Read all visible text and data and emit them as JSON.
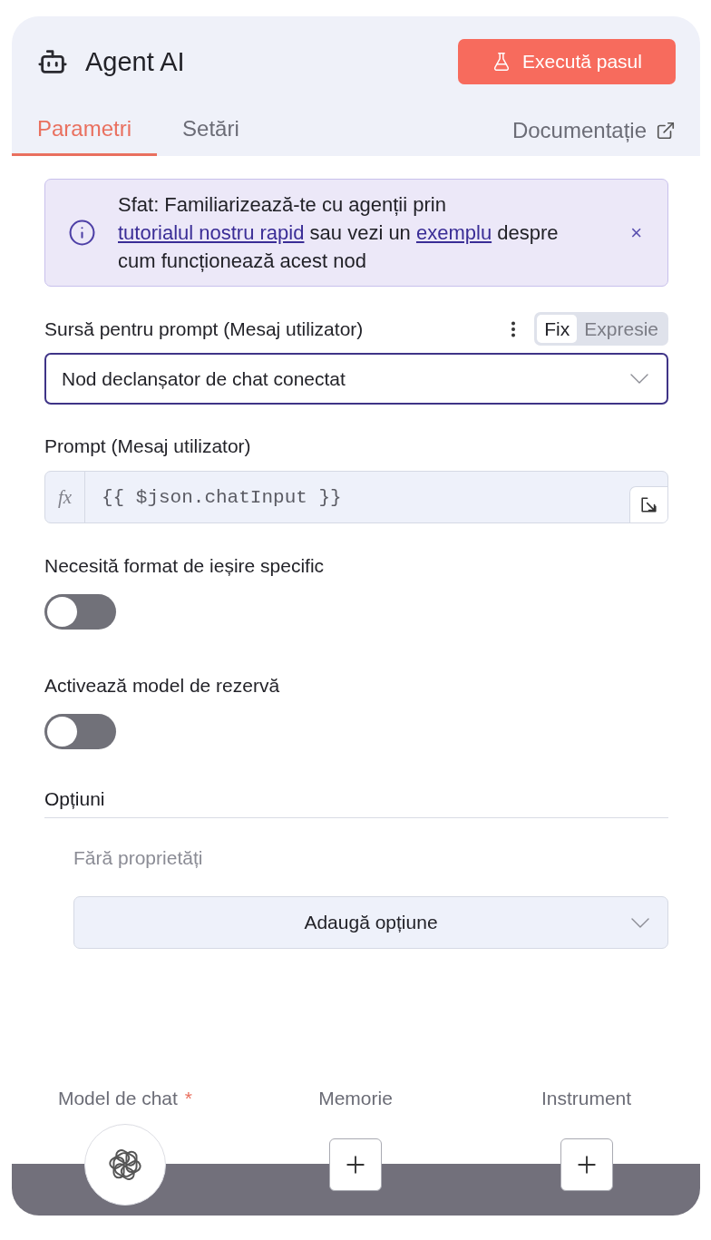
{
  "header": {
    "title": "Agent AI",
    "run_button": "Execută pasul"
  },
  "tabs": [
    {
      "label": "Parametri",
      "selected": true
    },
    {
      "label": "Setări",
      "selected": false
    }
  ],
  "docs_link": "Documentație",
  "tip": {
    "parts": [
      {
        "kind": "text",
        "text": "Sfat: Familiarizează-te cu agenții prin "
      },
      {
        "kind": "link",
        "text": "tutorialul nostru rapid"
      },
      {
        "kind": "text",
        "text": " sau vezi un "
      },
      {
        "kind": "link",
        "text": "exemplu"
      },
      {
        "kind": "text",
        "text": " despre cum funcționează acest nod"
      }
    ],
    "close": "×"
  },
  "prompt_source": {
    "label": "Sursă pentru prompt (Mesaj utilizator)",
    "modes": [
      {
        "label": "Fix",
        "selected": true
      },
      {
        "label": "Expresie",
        "selected": false
      }
    ],
    "value": "Nod declanșator de chat conectat"
  },
  "prompt": {
    "label": "Prompt (Mesaj utilizator)",
    "prefix": "fx",
    "value": "{{ $json.chatInput }}"
  },
  "toggles": [
    {
      "label": "Necesită format de ieșire specific",
      "on": false
    },
    {
      "label": "Activează model de rezervă",
      "on": false
    }
  ],
  "options": {
    "title": "Opțiuni",
    "empty_text": "Fără proprietăți",
    "add_button": "Adaugă opțiune"
  },
  "connections": [
    {
      "kind": "model",
      "label": "Model de chat",
      "marker": "*"
    },
    {
      "kind": "add",
      "label": "Memorie"
    },
    {
      "kind": "add",
      "label": "Instrument"
    }
  ]
}
